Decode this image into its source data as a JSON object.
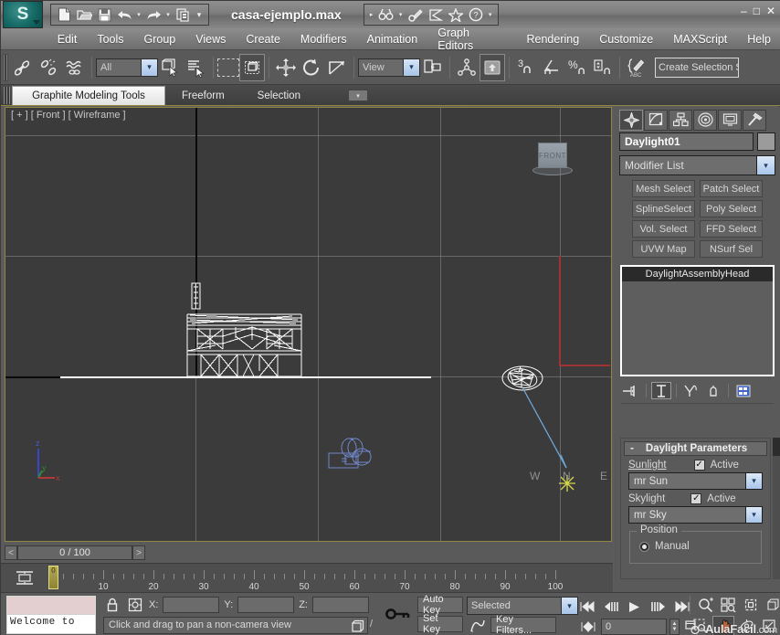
{
  "titlebar": {
    "document_title": "casa-ejemplo.max",
    "logo_label": "S",
    "quick_access_left": [
      {
        "name": "new-file-icon",
        "glyph": "⬜"
      },
      {
        "name": "open-file-icon",
        "glyph": "📂"
      },
      {
        "name": "save-file-icon",
        "glyph": "💾"
      },
      {
        "name": "undo-icon",
        "glyph": "↶"
      },
      {
        "name": "undo-dropdown-icon",
        "glyph": "▾"
      },
      {
        "name": "redo-icon",
        "glyph": "↷"
      },
      {
        "name": "redo-dropdown-icon",
        "glyph": "▾"
      },
      {
        "name": "set-project-folder-icon",
        "glyph": "❑"
      },
      {
        "name": "quick-access-dropdown-icon",
        "glyph": "▾"
      }
    ],
    "quick_access_right": [
      {
        "name": "qat-expand-icon",
        "glyph": "▸"
      },
      {
        "name": "scene-explorer-icon",
        "glyph": "☍"
      },
      {
        "name": "scene-explorer-dropdown-icon",
        "glyph": "▾"
      },
      {
        "name": "material-editor-icon",
        "glyph": "🔧"
      },
      {
        "name": "render-setup-icon",
        "glyph": "☂"
      },
      {
        "name": "favorites-icon",
        "glyph": "☆"
      },
      {
        "name": "help-icon",
        "glyph": "?"
      },
      {
        "name": "help-dropdown-icon",
        "glyph": "▾"
      }
    ],
    "window_buttons": [
      {
        "name": "minimize-button",
        "glyph": "–"
      },
      {
        "name": "maximize-button",
        "glyph": "□"
      },
      {
        "name": "close-button",
        "glyph": "✕"
      }
    ]
  },
  "menubar": {
    "items": [
      "Edit",
      "Tools",
      "Group",
      "Views",
      "Create",
      "Modifiers",
      "Animation",
      "Graph Editors",
      "Rendering",
      "Customize",
      "MAXScript",
      "Help"
    ]
  },
  "maintoolbar": {
    "selection_filter": "All",
    "reference_coordinate_system": "View",
    "create_selection_set_placeholder": "Create Selection S",
    "icons": [
      {
        "name": "select-and-link-icon",
        "glyph": "🔗"
      },
      {
        "name": "unlink-selection-icon",
        "glyph": "🔗"
      },
      {
        "name": "bind-to-space-warp-icon",
        "glyph": "≋"
      },
      {
        "name": "select-object-icon",
        "glyph": "◱"
      },
      {
        "name": "select-by-name-icon",
        "glyph": "☰"
      },
      {
        "name": "rectangular-selection-region-icon",
        "glyph": "▭"
      },
      {
        "name": "window-crossing-toggle-icon",
        "glyph": "▣"
      },
      {
        "name": "select-and-move-icon",
        "glyph": "✥"
      },
      {
        "name": "select-and-rotate-icon",
        "glyph": "↻"
      },
      {
        "name": "select-and-scale-icon",
        "glyph": "⤡"
      },
      {
        "name": "use-center-flyout-icon",
        "glyph": "◨"
      },
      {
        "name": "mirror-icon",
        "glyph": "⬌"
      },
      {
        "name": "align-icon",
        "glyph": "⬆"
      },
      {
        "name": "snap-toggle-icon",
        "glyph": "3"
      },
      {
        "name": "angle-snap-toggle-icon",
        "glyph": "∠"
      },
      {
        "name": "percent-snap-toggle-icon",
        "glyph": "%"
      },
      {
        "name": "spinner-snap-toggle-icon",
        "glyph": "⇅"
      },
      {
        "name": "edit-named-selection-sets-icon",
        "glyph": "✎"
      }
    ]
  },
  "ribbon": {
    "tabs": [
      {
        "label": "Graphite Modeling Tools",
        "active": true
      },
      {
        "label": "Freeform",
        "active": false
      },
      {
        "label": "Selection",
        "active": false
      }
    ],
    "dropdown_glyph": "▾"
  },
  "viewport": {
    "label": "[ + ] [ Front ] [ Wireframe ]",
    "viewcube_face": "FRONT",
    "compass": {
      "west": "W",
      "north": "N",
      "east": "E"
    },
    "tripod_axes": [
      "z",
      "y",
      "x"
    ],
    "colors": {
      "background": "#3b3b3b",
      "wireframe": "#ffffff",
      "selected_light": "#ffffff",
      "light_ray": "#6ea8d8",
      "x_axis": "#b03a3a",
      "border": "#8f8544"
    }
  },
  "timeslider": {
    "prev_frame_glyph": "<",
    "next_frame_glyph": ">",
    "frame_indicator": "0 / 100",
    "current_frame_label": "0",
    "ruler_labels": [
      "10",
      "20",
      "30",
      "40",
      "50",
      "60",
      "70",
      "80",
      "90",
      "100"
    ],
    "track_view_icon": "☰"
  },
  "statusbar": {
    "message_log_text": "Welcome to",
    "lock_selection_icon": "🔒",
    "selection_lock_toggle_icon": "⬚",
    "coordinate_labels": [
      "X:",
      "Y:",
      "Z:"
    ],
    "coordinate_values": [
      "",
      "",
      ""
    ],
    "prompt_text": "Click and drag to pan a non-camera view",
    "adaptive_degradation_icon": "◱",
    "key_mode_icon": "⚷",
    "auto_key_label": "Auto Key",
    "set_key_label": "Set Key",
    "animation_mode": "Selected",
    "key_filters_label": "Key Filters...",
    "curve_editor_icon": "∿",
    "playback": [
      {
        "name": "goto-start-button",
        "glyph": "⏮"
      },
      {
        "name": "previous-frame-button",
        "glyph": "⏪"
      },
      {
        "name": "play-animation-button",
        "glyph": "▶"
      },
      {
        "name": "next-frame-button",
        "glyph": "⏩"
      },
      {
        "name": "goto-end-button",
        "glyph": "⏭"
      }
    ],
    "key_step_icon": "⏯",
    "current_time_field": "0",
    "time_configuration_icon": "⏱",
    "viewport_nav": [
      {
        "name": "zoom-button",
        "glyph": "🔍"
      },
      {
        "name": "zoom-all-button",
        "glyph": "⊞"
      },
      {
        "name": "zoom-extents-button",
        "glyph": "▣"
      },
      {
        "name": "zoom-region-button",
        "glyph": "⬚"
      },
      {
        "name": "field-of-view-button",
        "glyph": "⛶"
      },
      {
        "name": "pan-view-button",
        "glyph": "✋",
        "active": true
      },
      {
        "name": "orbit-button",
        "glyph": "⥁"
      },
      {
        "name": "maximize-viewport-toggle-button",
        "glyph": "⬌"
      }
    ],
    "watermark_main": "AulaFacil",
    "watermark_suffix": ".com"
  },
  "commandpanel": {
    "tabs": [
      {
        "name": "create-tab",
        "glyph": "✶",
        "active": true
      },
      {
        "name": "modify-tab",
        "glyph": "◩",
        "active": false
      },
      {
        "name": "hierarchy-tab",
        "glyph": "⛓",
        "active": false
      },
      {
        "name": "motion-tab",
        "glyph": "◎",
        "active": false
      },
      {
        "name": "display-tab",
        "glyph": "⬚",
        "active": false
      },
      {
        "name": "utilities-tab",
        "glyph": "🔨",
        "active": false
      }
    ],
    "object_name": "Daylight01",
    "modifier_list_label": "Modifier List",
    "modifier_buttons": [
      "Mesh Select",
      "Patch Select",
      "SplineSelect",
      "Poly Select",
      "Vol. Select",
      "FFD Select",
      "UVW Map",
      "NSurf Sel"
    ],
    "stack_entries": [
      "DaylightAssemblyHead"
    ],
    "stack_icons": [
      {
        "name": "pin-stack-icon",
        "glyph": "⊸"
      },
      {
        "name": "show-end-result-icon",
        "glyph": "⌶",
        "active": true
      },
      {
        "name": "make-unique-icon",
        "glyph": "⅄"
      },
      {
        "name": "remove-modifier-icon",
        "glyph": "♻"
      },
      {
        "name": "configure-modifier-sets-icon",
        "glyph": "▦"
      }
    ],
    "rollout": {
      "title": "Daylight Parameters",
      "collapse_glyph": "-",
      "sunlight_label": "Sunlight",
      "sunlight_active_label": "Active",
      "sunlight_active_checked": true,
      "sunlight_value": "mr Sun",
      "skylight_label": "Skylight",
      "skylight_active_label": "Active",
      "skylight_active_checked": true,
      "skylight_value": "mr Sky",
      "position_group_label": "Position",
      "position_option": "Manual",
      "position_selected": true
    }
  }
}
